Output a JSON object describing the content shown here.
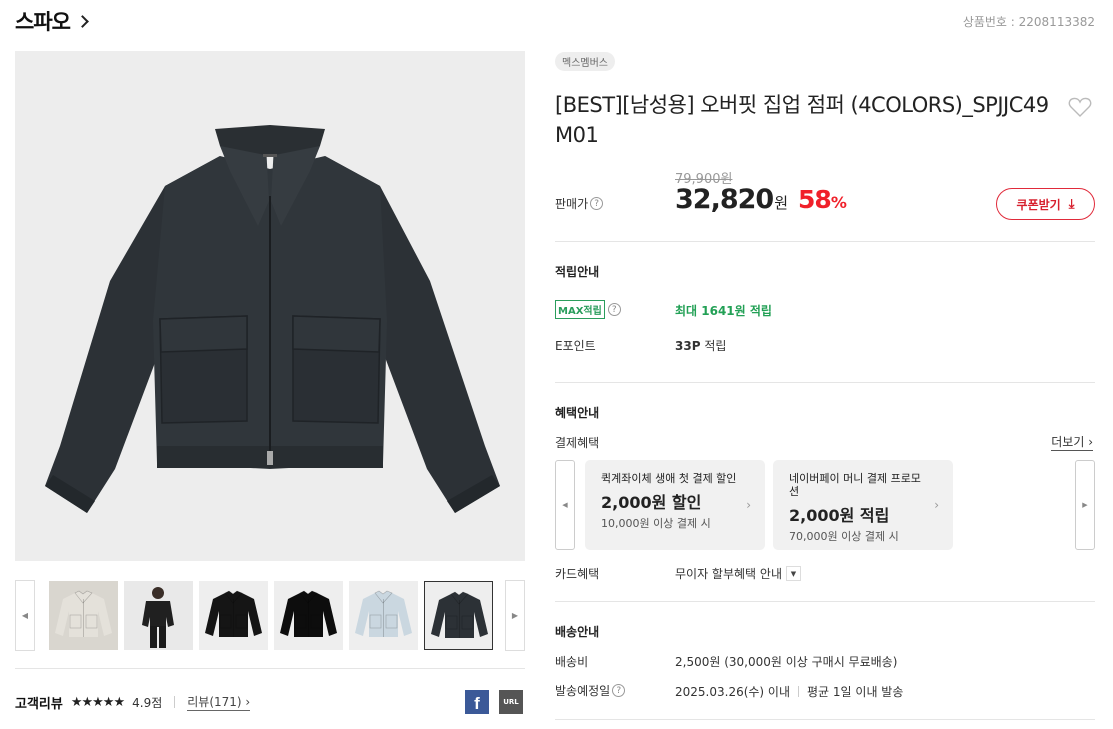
{
  "brand": {
    "name": "스파오"
  },
  "product_no": "상품번호 : 2208113382",
  "tag": "멕스멤버스",
  "title": "[BEST][남성용] 오버핏 집업 점퍼 (4COLORS)_SPJJC49M01",
  "price": {
    "original": "79,900원",
    "label": "판매가",
    "amount": "32,820",
    "unit": "원",
    "discount": "58",
    "discount_unit": "%"
  },
  "coupon_button": "쿠폰받기",
  "points": {
    "title": "적립안내",
    "max_badge": "MAX적립",
    "max_value": "최대 1641원 적립",
    "epoint_label": "E포인트",
    "epoint_value_bold": "33P",
    "epoint_value_rest": " 적립"
  },
  "benefits": {
    "title": "혜택안내",
    "payment_label": "결제혜택",
    "more": "더보기",
    "cards": [
      {
        "title": "퀵계좌이체 생애 첫 결제 할인",
        "amount": "2,000원 할인",
        "sub": "10,000원 이상 결제 시"
      },
      {
        "title": "네이버페이 머니 결제 프로모션",
        "amount": "2,000원 적립",
        "sub": "70,000원 이상 결제 시"
      }
    ],
    "card_label": "카드혜택",
    "card_value": "무이자 할부혜택 안내"
  },
  "shipping": {
    "title": "배송안내",
    "fee_label": "배송비",
    "fee_value": "2,500원 (30,000원 이상 구매시 무료배송)",
    "date_label": "발송예정일",
    "date_value": "2025.03.26(수) 이내",
    "avg_value": "평균 1일 이내 발송"
  },
  "reviews": {
    "title": "고객리뷰",
    "stars": "★★★★★",
    "rating": "4.9점",
    "link": "리뷰(171)"
  },
  "share": {
    "facebook": "f",
    "url": "URL"
  },
  "thumbnails": [
    {
      "color": "#d9d6cf",
      "kind": "jacket",
      "jacket": "#e4e1da"
    },
    {
      "color": "#e9e9e9",
      "kind": "model",
      "jacket": "#202020"
    },
    {
      "color": "#eeeeee",
      "kind": "jacket",
      "jacket": "#151515"
    },
    {
      "color": "#eeeeee",
      "kind": "jacket",
      "jacket": "#0d0d0d"
    },
    {
      "color": "#eeeeee",
      "kind": "jacket",
      "jacket": "#cad7e0"
    },
    {
      "color": "#eeeeee",
      "kind": "jacket",
      "jacket": "#2c3136"
    }
  ],
  "colors": {
    "accent_red": "#f0202a",
    "accent_green": "#22a055",
    "facebook": "#3b5998"
  }
}
